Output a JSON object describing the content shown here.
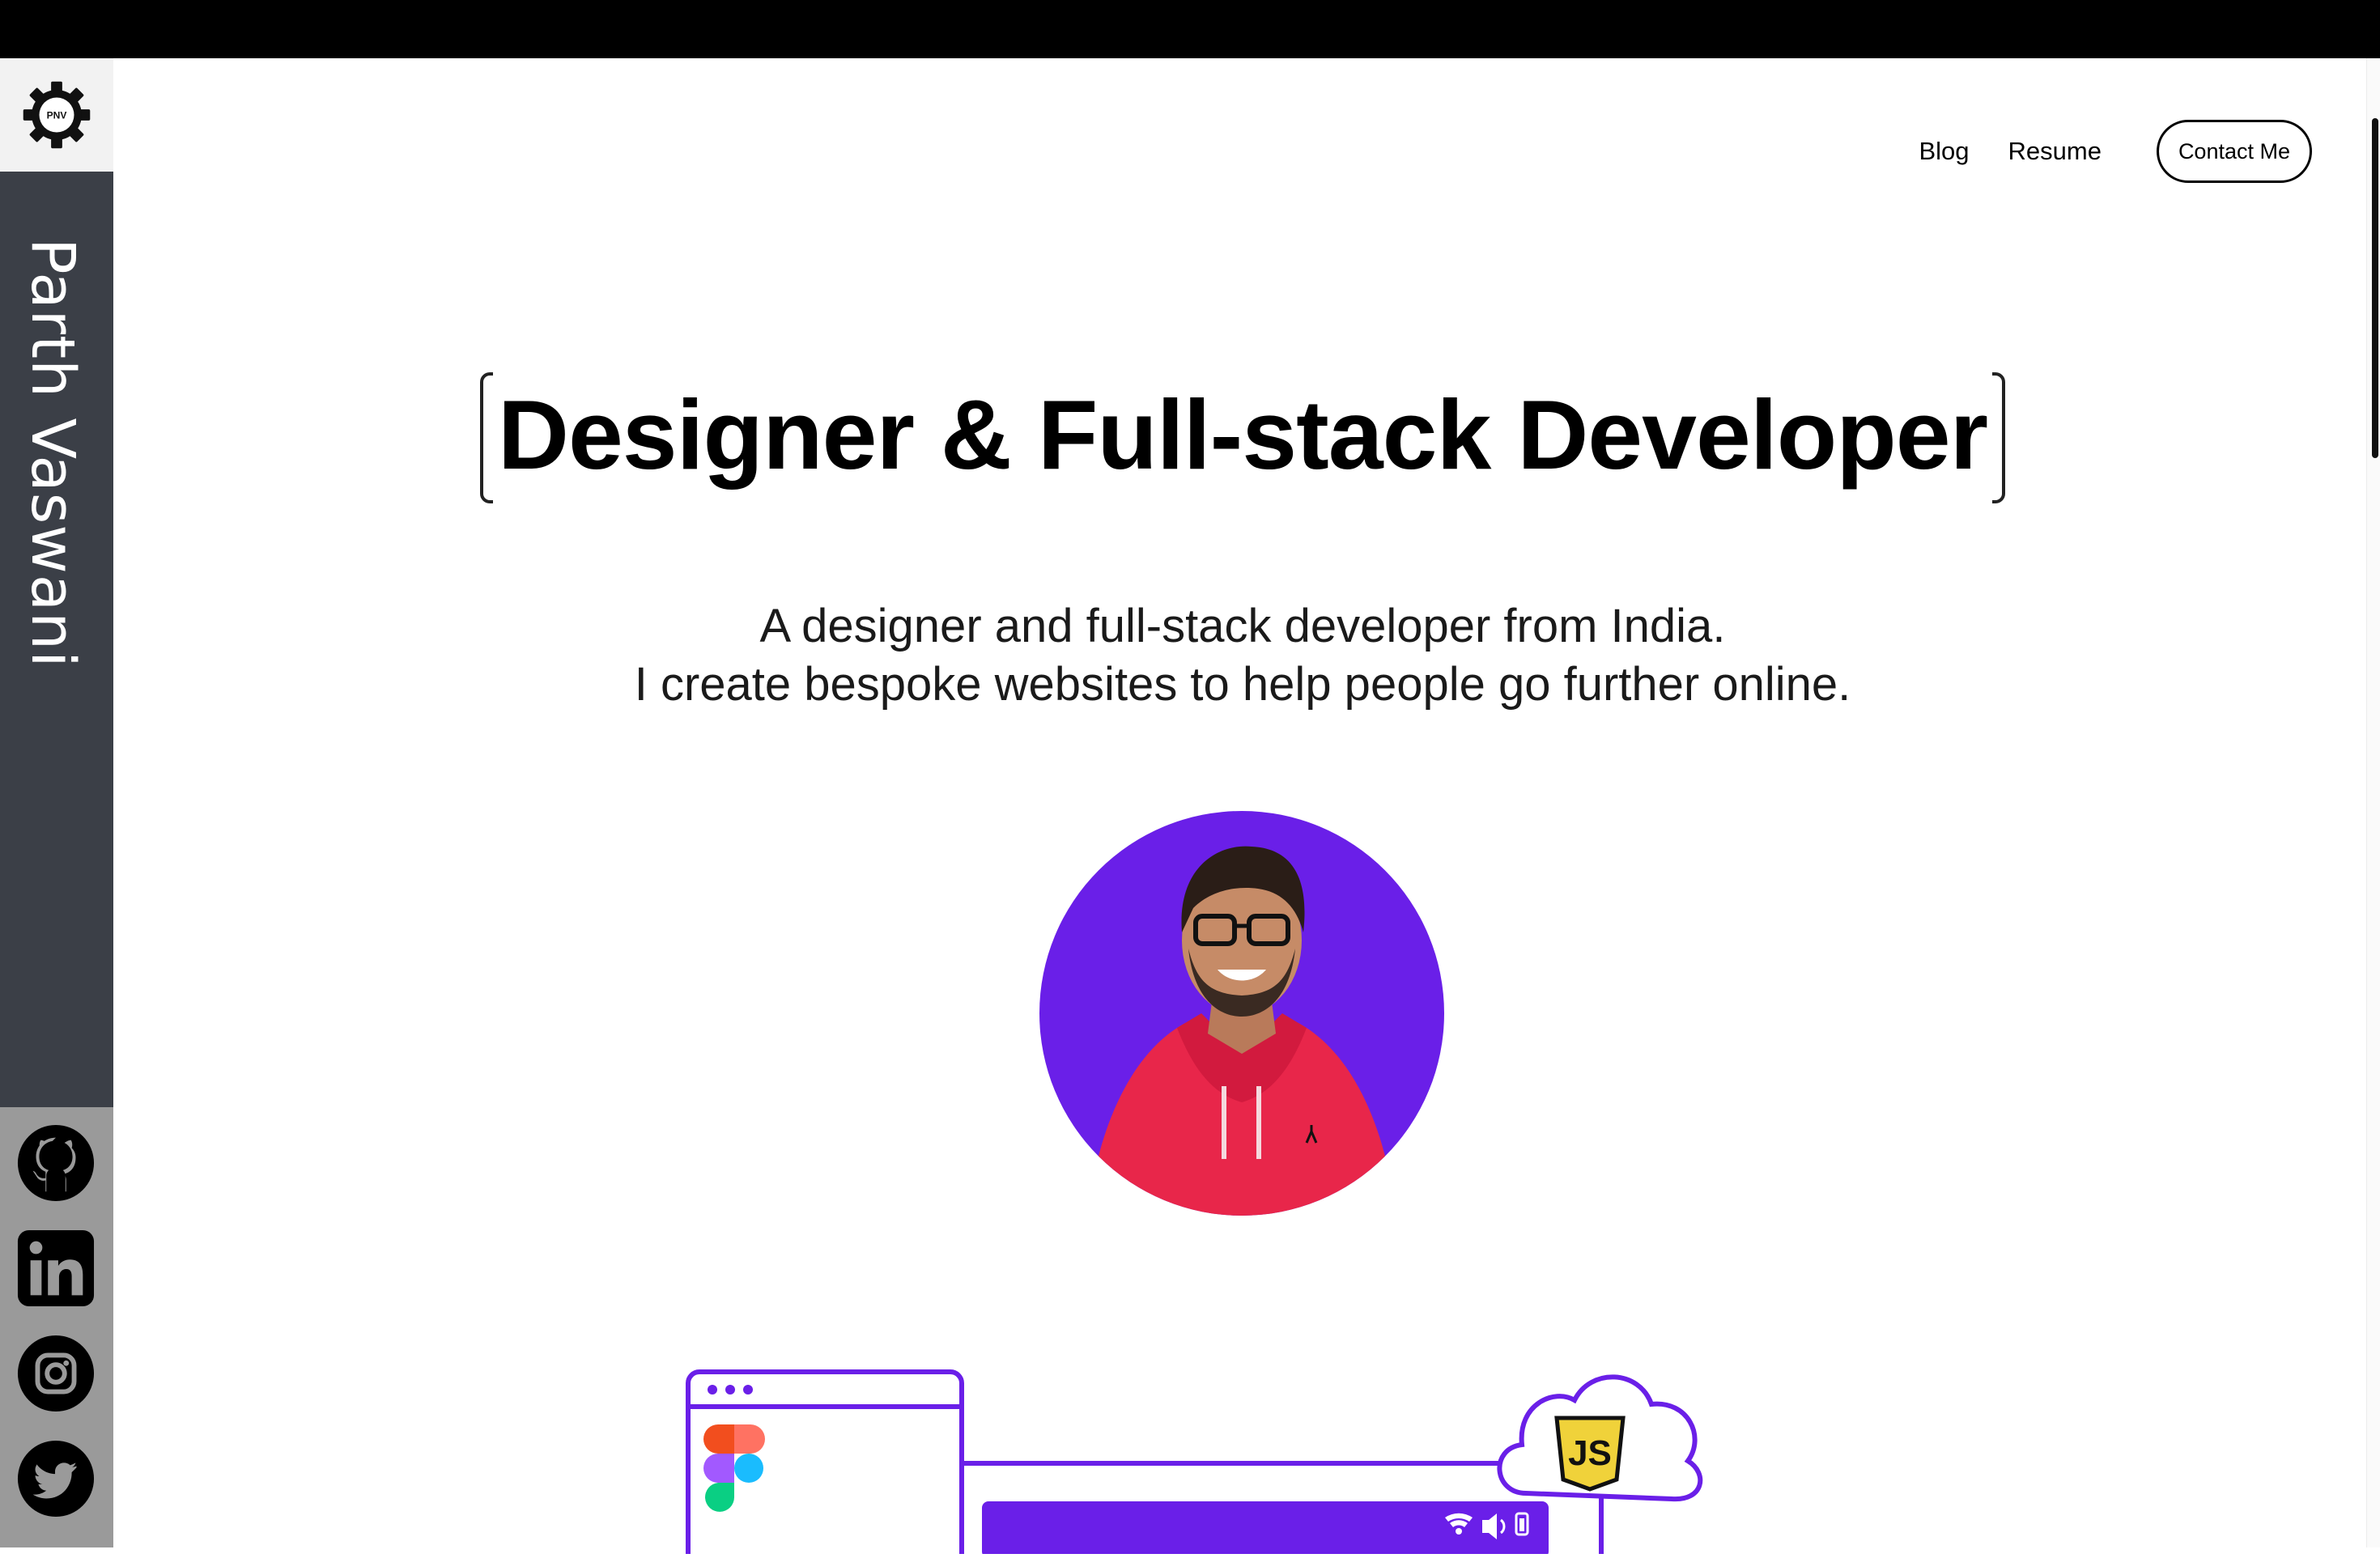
{
  "brand": {
    "logo_text": "PNV",
    "name": "Parth Vaswani"
  },
  "social": [
    {
      "icon": "github-icon"
    },
    {
      "icon": "linkedin-icon"
    },
    {
      "icon": "instagram-icon"
    },
    {
      "icon": "twitter-icon"
    }
  ],
  "nav": {
    "blog": "Blog",
    "resume": "Resume",
    "contact": "Contact Me"
  },
  "hero": {
    "title": "Designer & Full-stack Developer",
    "line1": "A designer and full-stack developer from India.",
    "line2": "I create bespoke websites to help people go further online."
  },
  "illustration": {
    "cloud_badge": "JS"
  },
  "colors": {
    "accent_purple": "#6a1fe8",
    "sidebar_dark": "#3b3f47",
    "sidebar_grey": "#9a9a9a",
    "topbar": "#000000",
    "js_yellow": "#f0d23a"
  }
}
